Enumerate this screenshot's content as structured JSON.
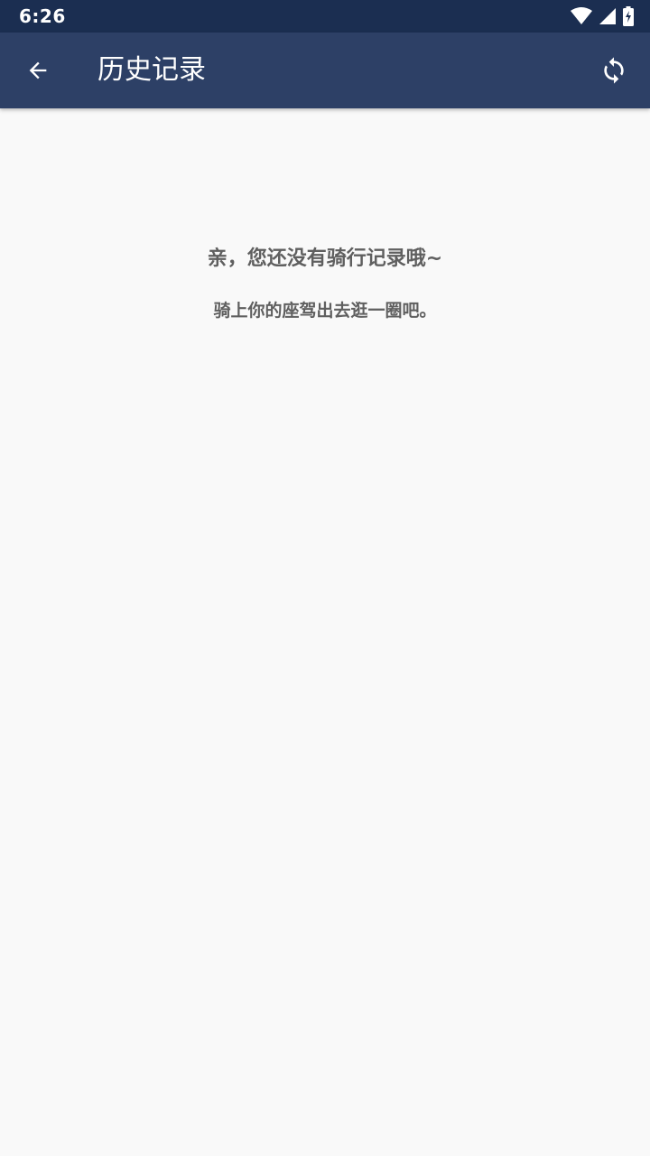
{
  "status_bar": {
    "time": "6:26",
    "icons": [
      "wifi-icon",
      "signal-icon",
      "battery-charging-icon"
    ]
  },
  "app_bar": {
    "title": "历史记录",
    "back_icon": "arrow-back-icon",
    "refresh_icon": "refresh-icon"
  },
  "empty_state": {
    "title": "亲，您还没有骑行记录哦~",
    "subtitle": "骑上你的座驾出去逛一圈吧。"
  },
  "colors": {
    "status_bar_bg": "#1b2e51",
    "app_bar_bg": "#2d4066",
    "page_bg": "#f9f9f9",
    "text_gray": "#5f5f5f"
  }
}
